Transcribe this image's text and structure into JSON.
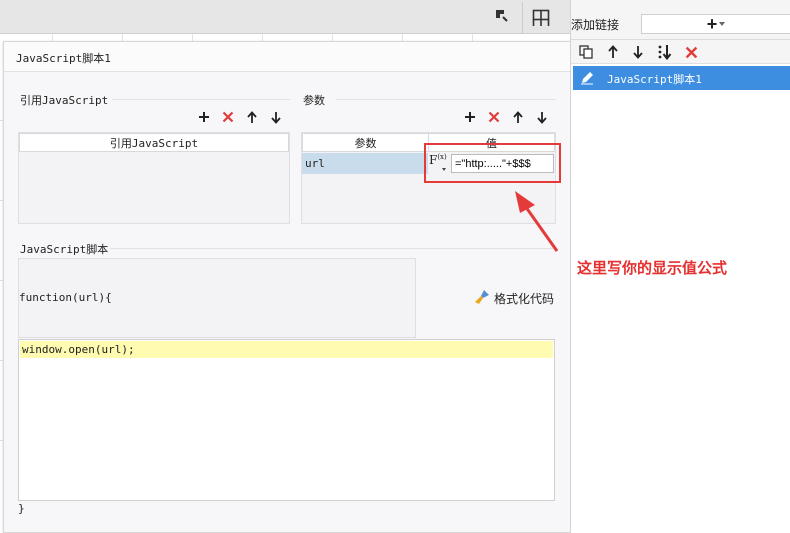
{
  "window": {
    "layout_icon": "layout-grid-icon",
    "corner_icon": "corner-marker-icon"
  },
  "dialog": {
    "title": "JavaScript脚本1",
    "ref_js": {
      "section_label": "引用JavaScript",
      "column_header": "引用JavaScript"
    },
    "params": {
      "section_label": "参数",
      "column_headers": [
        "参数",
        "值"
      ],
      "rows": [
        {
          "name": "url",
          "fx_label": "F",
          "fx_sub": "(x)",
          "value": "=\"http:.....\"+$$$"
        }
      ]
    },
    "script": {
      "section_label": "JavaScript脚本",
      "function_header": "function(url){",
      "format_button": "格式化代码",
      "code_line": "window.open(url);",
      "closing_brace": "}"
    }
  },
  "right_panel": {
    "add_link_label": "添加链接",
    "add_link_combo": "+",
    "toolbar_icons": [
      "copy-icon",
      "arrow-up-icon",
      "arrow-down-icon",
      "sort-icon",
      "delete-icon"
    ],
    "link_item": "JavaScript脚本1"
  },
  "annotation": {
    "text": "这里写你的显示值公式"
  },
  "colors": {
    "accent": "#3d8ee0",
    "annotation_red": "#e53a3a",
    "delete_red": "#e23c3c",
    "code_highlight": "#fffbb0"
  }
}
